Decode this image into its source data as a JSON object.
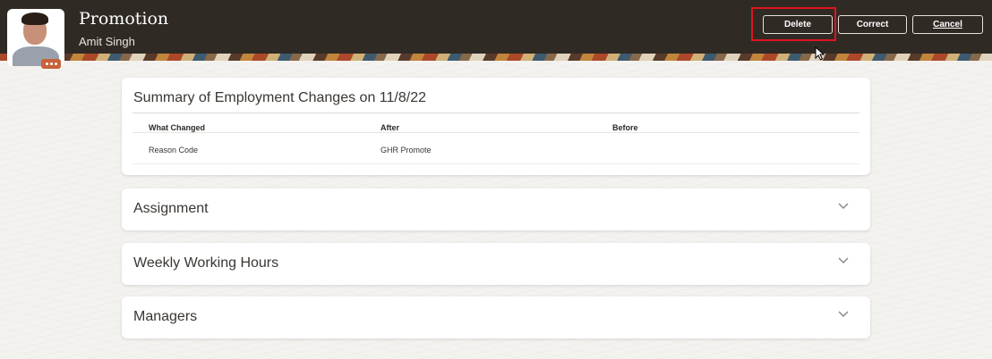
{
  "header": {
    "title": "Promotion",
    "person_name": "Amit Singh",
    "buttons": {
      "delete": "Delete",
      "correct": "Correct",
      "cancel": "Cancel"
    },
    "highlight_color": "#e0141e",
    "background_color": "#302a25",
    "avatar_menu_color": "#c8623a"
  },
  "summary": {
    "title": "Summary of Employment Changes on 11/8/22",
    "columns": [
      "What Changed",
      "After",
      "Before"
    ],
    "rows": [
      {
        "what_changed": "Reason Code",
        "after": "GHR Promote",
        "before": ""
      }
    ]
  },
  "sections": [
    {
      "title": "Assignment",
      "icon": "chevron-down-icon"
    },
    {
      "title": "Weekly Working Hours",
      "icon": "chevron-down-icon"
    },
    {
      "title": "Managers",
      "icon": "chevron-down-icon"
    }
  ]
}
